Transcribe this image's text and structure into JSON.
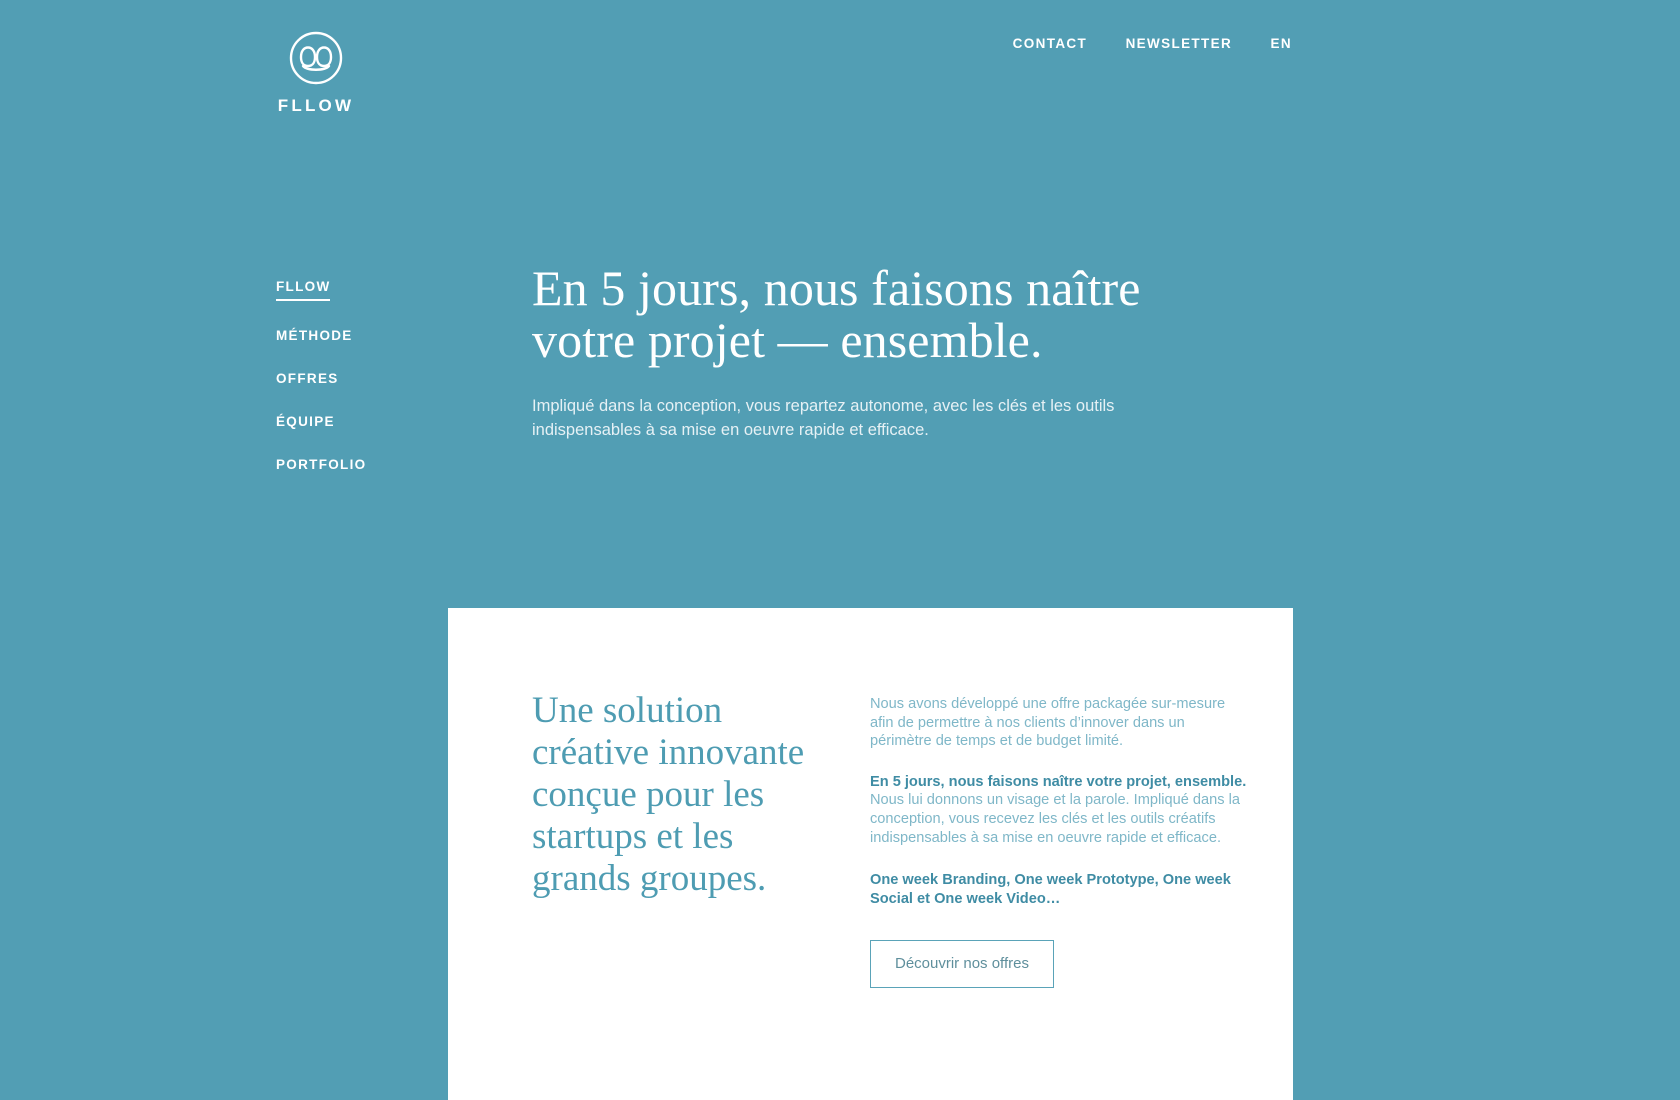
{
  "colors": {
    "background": "#529eb4",
    "card_background": "#ffffff",
    "accent_teal": "#4e9cb2",
    "body_text": "#7fb7c8",
    "white": "#ffffff"
  },
  "brand": {
    "mark": "fllow-loops-icon",
    "word": "FLLOW"
  },
  "topnav": {
    "items": [
      {
        "label": "CONTACT"
      },
      {
        "label": "NEWSLETTER"
      },
      {
        "label": "EN"
      }
    ]
  },
  "sidenav": {
    "items": [
      {
        "label": "FLLOW",
        "active": true
      },
      {
        "label": "MÉTHODE",
        "active": false
      },
      {
        "label": "OFFRES",
        "active": false
      },
      {
        "label": "ÉQUIPE",
        "active": false
      },
      {
        "label": "PORTFOLIO",
        "active": false
      }
    ]
  },
  "hero": {
    "title": "En 5 jours, nous faisons naître votre projet — ensemble.",
    "subtitle": "Impliqué dans la conception, vous repartez autonome, avec les clés et les outils indispensables à sa mise en oeuvre rapide et efficace."
  },
  "card": {
    "heading": "Une solution créative innovante conçue pour les startups et les grands groupes.",
    "paragraph_1": "Nous avons développé une offre packagée sur-mesure afin de permettre à nos clients d’innover dans un périmètre de temps et de budget limité.",
    "paragraph_2_bold": "En 5 jours, nous faisons naître votre projet, ensemble.",
    "paragraph_2_rest": " Nous lui donnons un visage et la parole. Impliqué dans la conception, vous recevez les clés et les outils créatifs indispensables à sa mise en oeuvre rapide et efficace.",
    "offers_line": "One week Branding, One week Prototype, One week Social et One week Video…",
    "cta_label": "Découvrir nos offres"
  }
}
